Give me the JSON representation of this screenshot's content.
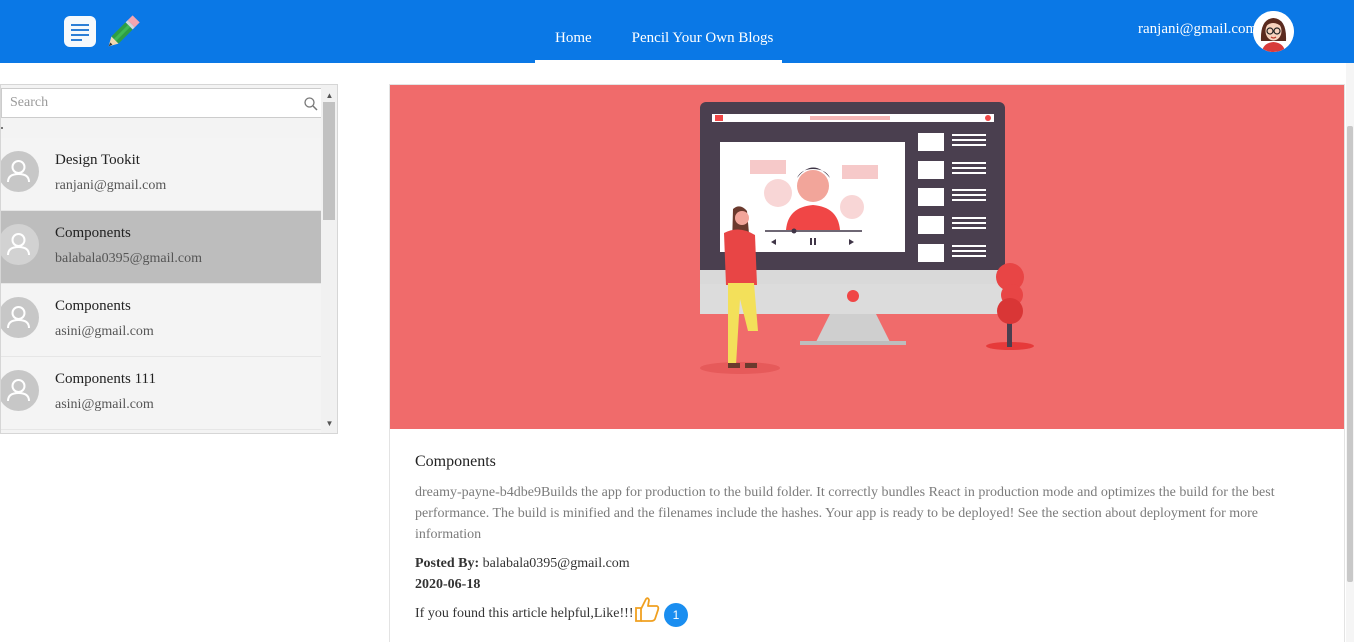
{
  "header": {
    "nav": [
      {
        "label": "Home"
      },
      {
        "label": "Pencil Your Own Blogs"
      }
    ],
    "user_email": "ranjani@gmail.com"
  },
  "sidebar": {
    "search_placeholder": "Search",
    "items": [
      {
        "title": "Design Tookit",
        "author": "ranjani@gmail.com",
        "active": false
      },
      {
        "title": "Components",
        "author": "balabala0395@gmail.com",
        "active": true
      },
      {
        "title": "Components",
        "author": "asini@gmail.com",
        "active": false
      },
      {
        "title": "Components 111",
        "author": "asini@gmail.com",
        "active": false
      }
    ]
  },
  "article": {
    "title": "Components",
    "description": "dreamy-payne-b4dbe9Builds the app for production to the build folder. It correctly bundles React in production mode and optimizes the build for the best performance. The build is minified and the filenames include the hashes. Your app is ready to be deployed! See the section about deployment for more information",
    "posted_by_label": "Posted By:",
    "posted_by": "balabala0395@gmail.com",
    "date": "2020-06-18",
    "like_prompt": "If you found this article helpful,Like!!!",
    "like_count": "1"
  },
  "colors": {
    "header_bg": "#0a78e6",
    "hero_bg": "#f06b6b",
    "active_item_bg": "#bdbdbd",
    "like_badge": "#1a8ef0"
  }
}
